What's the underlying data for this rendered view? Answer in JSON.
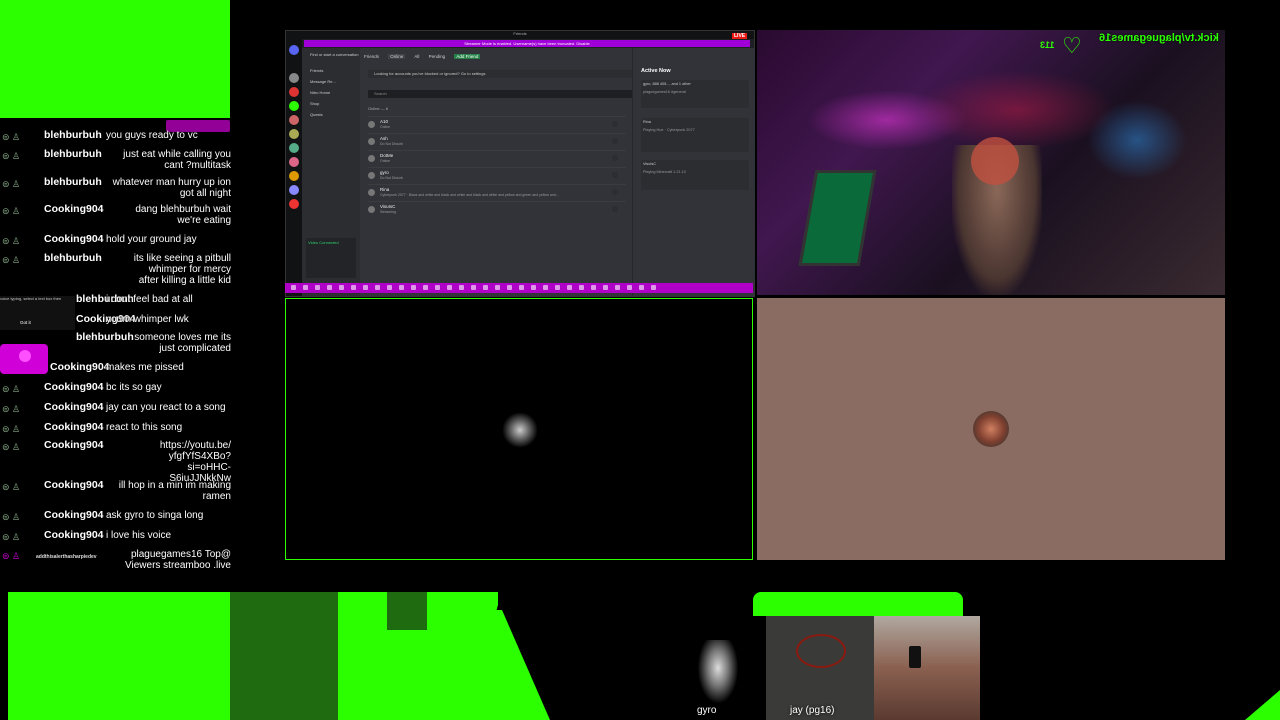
{
  "chat": {
    "messages": [
      {
        "user": "blehburbuh",
        "text": "you guys ready to vc"
      },
      {
        "user": "blehburbuh",
        "text": "just eat while calling you cant ?multitask"
      },
      {
        "user": "blehburbuh",
        "text": "whatever man hurry up ion got all night"
      },
      {
        "user": "Cooking904",
        "text": "dang blehburbuh wait we're eating"
      },
      {
        "user": "Cooking904",
        "text": "hold your ground jay"
      },
      {
        "user": "blehburbuh",
        "text": "its like seeing a pitbull whimper for mercy after killing a little kid"
      },
      {
        "user": "blehburbuh",
        "text": "i dont feel bad at all"
      },
      {
        "user": "Cooking904",
        "text": "yourn whimper lwk"
      },
      {
        "user": "blehburbuh",
        "text": "someone loves me its just complicated"
      },
      {
        "user": "Cooking904",
        "text": "makes me pissed"
      },
      {
        "user": "Cooking904",
        "text": "bc its so gay"
      },
      {
        "user": "Cooking904",
        "text": "jay can you react to a song"
      },
      {
        "user": "Cooking904",
        "text": "react to this song"
      },
      {
        "user": "Cooking904",
        "text": "https://youtu.be/ yfgfYfS4XBo?si=oHHC- S6iuJJNkkNw"
      },
      {
        "user": "Cooking904",
        "text": "ill hop in a min im making ramen"
      },
      {
        "user": "Cooking904",
        "text": "ask gyro to singa long"
      },
      {
        "user": "Cooking904",
        "text": "i love his voice"
      },
      {
        "user": "addthisalerthasharpiedev",
        "text": "plaguegames16 Top@ Viewers streamboo .live"
      }
    ],
    "voice_typing_hint": "voice typing, select a text box then",
    "got_it": "Got it"
  },
  "discord": {
    "title": "Friends",
    "banner": "Streamer Mode is enabled. Username(s) have been truncated.   Disable",
    "live_badge": "LIVE",
    "channels": [
      "Friends",
      "Message Re...",
      "Nitro Home",
      "Shop",
      "Quests"
    ],
    "tabs": [
      "Friends",
      "Online",
      "All",
      "Pending",
      "Add Friend"
    ],
    "notice": "Looking for accounts you've blocked or ignored? Go to settings",
    "search_placeholder": "Search",
    "online_count": "Online — 6",
    "friends": [
      {
        "name": "A10",
        "status": "Online"
      },
      {
        "name": "Ash",
        "status": "Do Not Disturb"
      },
      {
        "name": "DotMe",
        "status": "Online"
      },
      {
        "name": "gyro",
        "status": "Do Not Disturb"
      },
      {
        "name": "Rina",
        "status": "Cyberpunk 2077 · Black and white and black and white and black and white and yellow and green and yellow and..."
      },
      {
        "name": "VisuIsC",
        "status": "Streaming"
      }
    ],
    "active_now_title": "Active Now",
    "active_cards": [
      {
        "title": "gyro, 888 405..., and 1 other",
        "sub": "plaguegames16 #general"
      },
      {
        "title": "Rina",
        "sub": "Playing Hue · Cyberpunk 2077"
      },
      {
        "title": "VisuIsC",
        "sub": "Playing Minecraft 1.21.10"
      }
    ],
    "voice_panel": "Video Connected"
  },
  "stream_overlay": {
    "kick_handle": "kick.tv/plaguegames16",
    "follower_count": "113"
  },
  "bottom": {
    "left_name": "gyro",
    "right_name": "jay (pg16)"
  }
}
